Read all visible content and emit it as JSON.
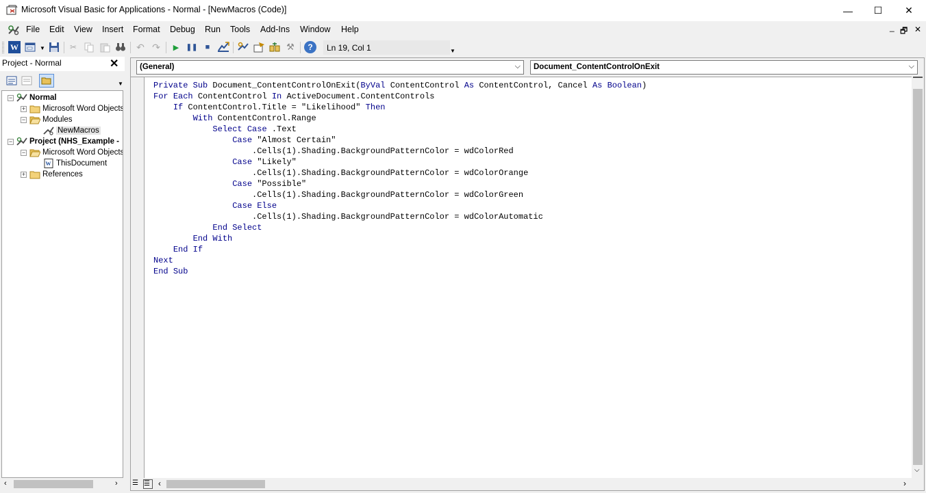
{
  "window": {
    "title": "Microsoft Visual Basic for Applications - Normal - [NewMacros (Code)]",
    "controls": {
      "minimize": "—",
      "maximize": "☐",
      "close": "✕"
    }
  },
  "menu": {
    "items": [
      "File",
      "Edit",
      "View",
      "Insert",
      "Format",
      "Debug",
      "Run",
      "Tools",
      "Add-Ins",
      "Window",
      "Help"
    ],
    "mdi_controls": {
      "minimize": "_",
      "restore": "🗗",
      "close": "✕"
    }
  },
  "toolbar": {
    "position_readout": "Ln 19, Col 1",
    "icons": [
      "word-icon",
      "insert-userform-icon",
      "save-icon",
      "cut-icon",
      "copy-icon",
      "paste-icon",
      "find-icon",
      "undo-icon",
      "redo-icon",
      "run-icon",
      "break-icon",
      "reset-icon",
      "design-mode-icon",
      "project-explorer-icon",
      "properties-icon",
      "object-browser-icon",
      "toolbox-icon",
      "help-icon"
    ]
  },
  "project_panel": {
    "title": "Project - Normal",
    "close": "✕",
    "tree": [
      {
        "label": "Normal",
        "bold": true,
        "level": 0,
        "expander": "−"
      },
      {
        "label": "Microsoft Word Objects",
        "level": 1,
        "expander": "+"
      },
      {
        "label": "Modules",
        "level": 1,
        "expander": "−"
      },
      {
        "label": "NewMacros",
        "level": 2,
        "selected": true
      },
      {
        "label": "Project (NHS_Example -",
        "bold": true,
        "level": 0,
        "expander": "−"
      },
      {
        "label": "Microsoft Word Objects",
        "level": 1,
        "expander": "−"
      },
      {
        "label": "ThisDocument",
        "level": 2
      },
      {
        "label": "References",
        "level": 1,
        "expander": "+"
      }
    ]
  },
  "code_window": {
    "object_combo": "(General)",
    "procedure_combo": "Document_ContentControlOnExit",
    "lines": [
      "Private Sub Document_ContentControlOnExit(ByVal ContentControl As ContentControl, Cancel As Boolean)",
      "For Each ContentControl In ActiveDocument.ContentControls",
      "    If ContentControl.Title = \"Likelihood\" Then",
      "        With ContentControl.Range",
      "            Select Case .Text",
      "                Case \"Almost Certain\"",
      "                    .Cells(1).Shading.BackgroundPatternColor = wdColorRed",
      "                Case \"Likely\"",
      "                    .Cells(1).Shading.BackgroundPatternColor = wdColorOrange",
      "                Case \"Possible\"",
      "                    .Cells(1).Shading.BackgroundPatternColor = wdColorGreen",
      "                Case Else",
      "                    .Cells(1).Shading.BackgroundPatternColor = wdColorAutomatic",
      "            End Select",
      "        End With",
      "    End If",
      "Next",
      "End Sub"
    ],
    "keyword_color": "#00008b"
  }
}
